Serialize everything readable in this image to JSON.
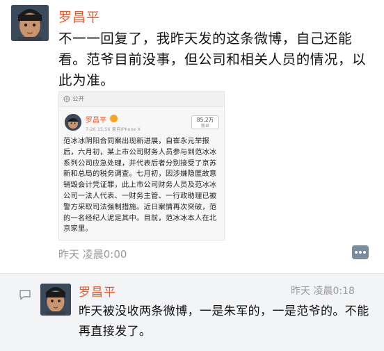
{
  "message1": {
    "sender": "罗昌平",
    "text": "不一一回复了，我昨天发的这条微博，自己还能看。范爷目前没事，但公司和相关人员的情况，以此为准。",
    "time": "昨天 凌晨0:00",
    "attachment": {
      "visibility": "公开",
      "author": "罗昌平",
      "time": "7-26 15:56 来自iPhone X",
      "fans_count": "85.2万",
      "fans_label": "粉丝",
      "body": "范冰冰阴阳合同案出现新进展，自崔永元举报后，六月初，某上市公司财务人员参与到范冰冰系列公司应急处理，并代表后者分别接受了京苏新和总局的税务调查。七月初，因涉嫌隐匿故意销毁会计凭证罪，此上市公司财务人员及范冰冰公司一法人代表、一财务主管、一行政助理已被警方采取司法强制措施。近日案情再次突破，范的一名经纪人泥足其中。目前，范冰冰本人在北京家里。"
    }
  },
  "message2": {
    "sender": "罗昌平",
    "time": "昨天 凌晨0:18",
    "text": "昨天被没收两条微博，一是朱军的，一是范爷的。不能再直接发了。"
  },
  "colors": {
    "name": "#ef5a2a",
    "time": "#999999",
    "reply_bg": "#f3f4f6"
  }
}
